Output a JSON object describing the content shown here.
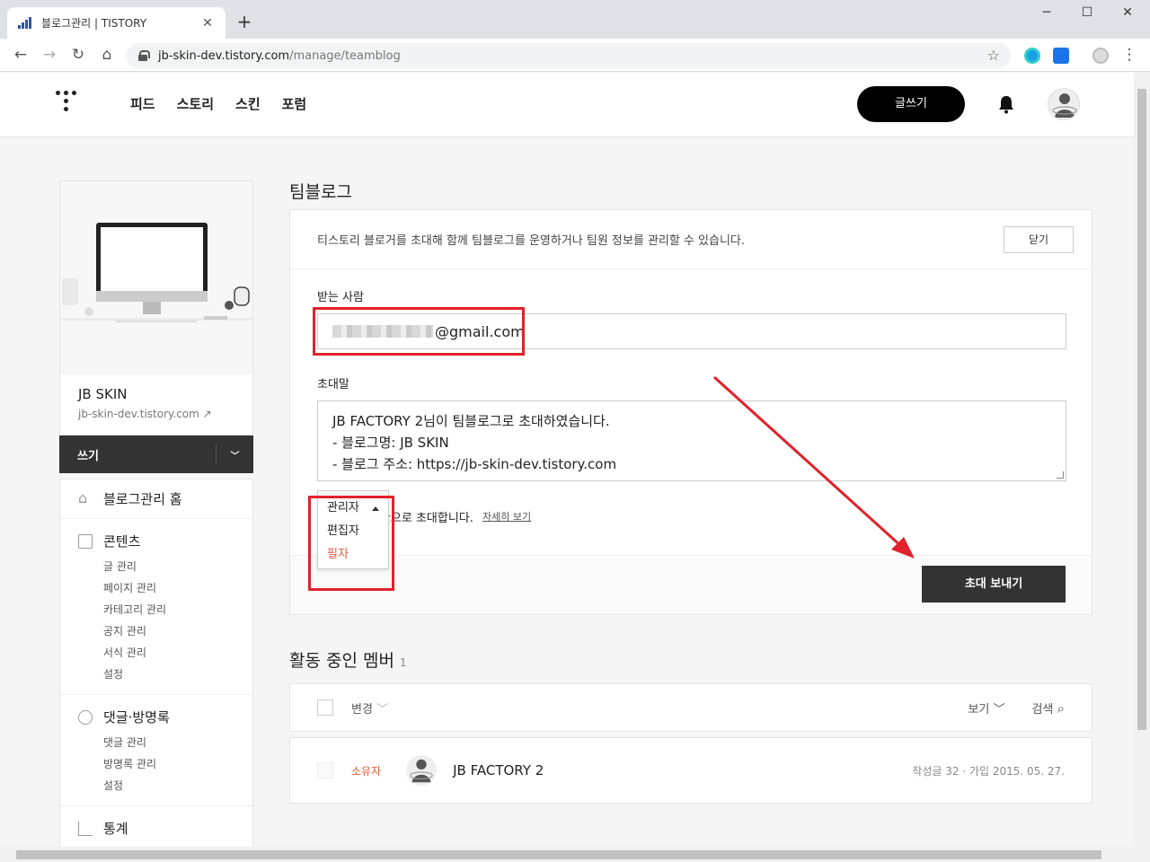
{
  "browser": {
    "tab_title": "블로그관리 | TISTORY",
    "tab_close": "✕",
    "new_tab": "+",
    "url_host": "jb-skin-dev.tistory.com",
    "url_path": "/manage/teamblog"
  },
  "header": {
    "nav": [
      "피드",
      "스토리",
      "스킨",
      "포럼"
    ],
    "write_button": "글쓰기"
  },
  "sidebar": {
    "blog_name": "JB SKIN",
    "blog_url": "jb-skin-dev.tistory.com",
    "write_label": "쓰기",
    "home": "블로그관리 홈",
    "sections": [
      {
        "title": "콘텐츠",
        "items": [
          "글 관리",
          "페이지 관리",
          "카테고리 관리",
          "공지 관리",
          "서식 관리",
          "설정"
        ]
      },
      {
        "title": "댓글·방명록",
        "items": [
          "댓글 관리",
          "방명록 관리",
          "설정"
        ]
      },
      {
        "title": "통계",
        "items": []
      }
    ]
  },
  "main": {
    "title": "팀블로그",
    "description": "티스토리 블로거를 초대해 함께 팀블로그를 운영하거나 팀원 정보를 관리할 수 있습니다.",
    "close_button": "닫기",
    "recipient_label": "받는 사람",
    "recipient_value": "@gmail.com",
    "message_label": "초대말",
    "message_lines": [
      "JB FACTORY 2님이 팀블로그로 초대하였습니다.",
      "- 블로그명: JB SKIN",
      "- 블로그 주소: https://jb-skin-dev.tistory.com"
    ],
    "role_suffix": "권한으로 초대합니다.",
    "role_link": "자세히 보기",
    "role_options": [
      "관리자",
      "편집자",
      "필자"
    ],
    "send_button": "초대 보내기"
  },
  "members": {
    "title": "활동 중인 멤버",
    "count": "1",
    "change": "변경",
    "view": "보기",
    "search": "검색",
    "rows": [
      {
        "role": "소유자",
        "name": "JB FACTORY 2",
        "meta": "작성글 32 · 가입 2015. 05. 27."
      }
    ],
    "current_page": "1"
  },
  "colors": {
    "accent": "#e55a3c",
    "annotation": "#e1222b",
    "dark": "#333333"
  }
}
